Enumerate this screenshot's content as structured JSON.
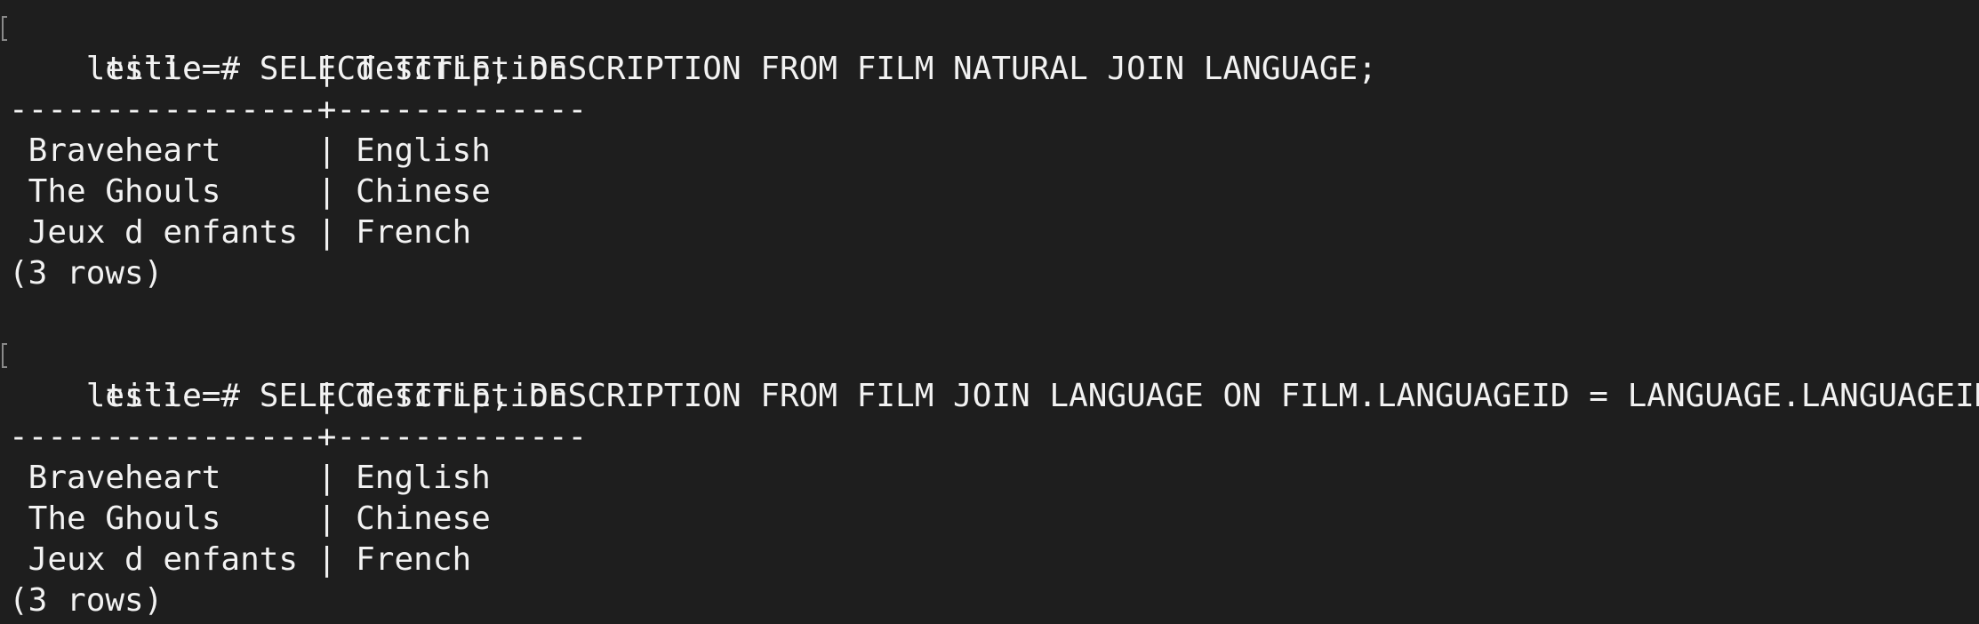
{
  "terminal": {
    "blocks": [
      {
        "prompt": "leslie=# ",
        "command": "SELECT TITLE, DESCRIPTION FROM FILM NATURAL JOIN LANGUAGE;",
        "header": "     title      | description",
        "separator": "----------------+-------------",
        "rows": [
          " Braveheart     | English",
          " The Ghouls     | Chinese",
          " Jeux d enfants | French"
        ],
        "footer": "(3 rows)"
      },
      {
        "prompt": "leslie=# ",
        "command": "SELECT TITLE, DESCRIPTION FROM FILM JOIN LANGUAGE ON FILM.LANGUAGEID = LANGUAGE.LANGUAGEID;",
        "header": "     title      | description",
        "separator": "----------------+-------------",
        "rows": [
          " Braveheart     | English",
          " The Ghouls     | Chinese",
          " Jeux d enfants | French"
        ],
        "footer": "(3 rows)"
      }
    ]
  }
}
